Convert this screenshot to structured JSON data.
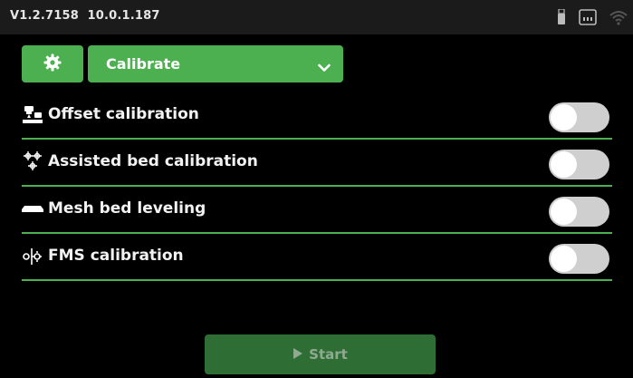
{
  "statusbar": {
    "version": "V1.2.7158",
    "ip": "10.0.1.187",
    "icons": [
      "usb-icon",
      "ethernet-icon",
      "wifi-icon"
    ]
  },
  "header": {
    "settings_icon": "gear-icon",
    "mode_select": {
      "selected": "Calibrate",
      "icon": "chevron-down-icon"
    }
  },
  "calibration_options": [
    {
      "label": "Offset calibration",
      "icon": "offset-calibration-icon",
      "enabled": false
    },
    {
      "label": "Assisted bed calibration",
      "icon": "assisted-bed-icon",
      "enabled": false
    },
    {
      "label": "Mesh bed leveling",
      "icon": "mesh-bed-icon",
      "enabled": false
    },
    {
      "label": "FMS calibration",
      "icon": "fms-calibration-icon",
      "enabled": false
    }
  ],
  "actions": {
    "start_label": "Start",
    "start_icon": "play-icon"
  },
  "colors": {
    "accent": "#4caf50",
    "start_disabled": "#2e6e34",
    "toggle_off": "#cfcfcf",
    "statusbar_bg": "#1b1b1b",
    "background": "#000000"
  }
}
